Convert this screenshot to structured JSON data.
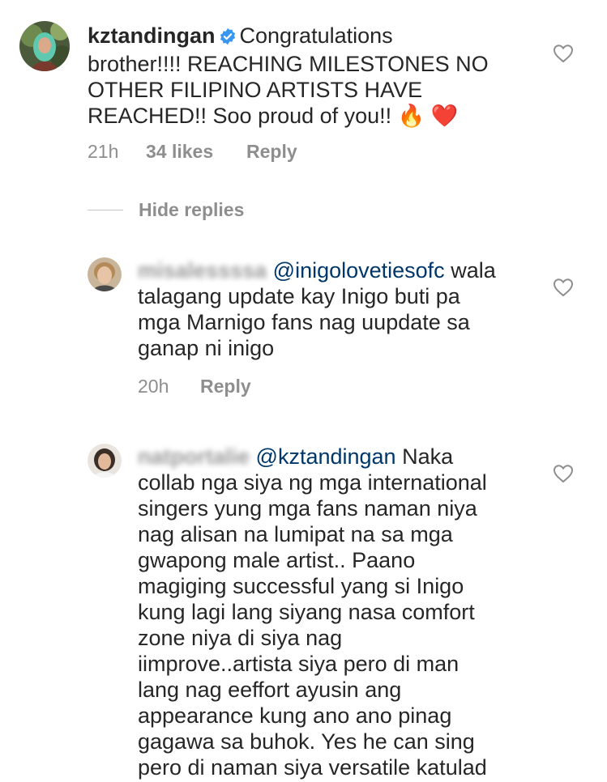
{
  "comments": [
    {
      "username": "kztandingan",
      "verified": true,
      "text_lines": [
        "Congratulations",
        "brother!!!! REACHING  MILESTONES NO",
        "OTHER FILIPINO ARTISTS HAVE",
        "REACHED!! Soo proud of you!! 🔥 ❤️"
      ],
      "time": "21h",
      "likes": "34 likes",
      "reply": "Reply"
    }
  ],
  "hide_replies_label": "Hide replies",
  "replies": [
    {
      "username": "misalessssa",
      "mention": "@inigolovetiesofc",
      "text_lines": [
        "wala",
        "talagang update kay Inigo buti pa",
        "mga Marnigo fans nag uupdate sa",
        "ganap ni inigo"
      ],
      "time": "20h",
      "reply": "Reply"
    },
    {
      "username": "natportalie",
      "mention": "@kztandingan",
      "text_lines": [
        "Naka",
        "collab nga siya ng mga international",
        "singers yung mga fans naman niya",
        "nag alisan na lumipat na sa mga",
        "gwapong male artist.. Paano",
        "magiging successful yang si Inigo",
        "kung lagi lang siyang nasa comfort",
        "zone niya di siya nag",
        "iimprove..artista siya pero di man",
        "lang nag eeffort ayusin ang",
        "appearance kung ano ano pinag",
        "gagawa sa buhok. Yes he can sing",
        "pero di naman siya versatile katulad"
      ]
    }
  ],
  "icons": {
    "like": "heart-outline-icon",
    "verified": "verified-badge-icon",
    "fire": "fire-emoji",
    "red_heart": "red-heart-emoji"
  },
  "colors": {
    "text": "#262626",
    "secondary": "#8e8e8e",
    "mention": "#00376b",
    "verified": "#3897f0"
  }
}
